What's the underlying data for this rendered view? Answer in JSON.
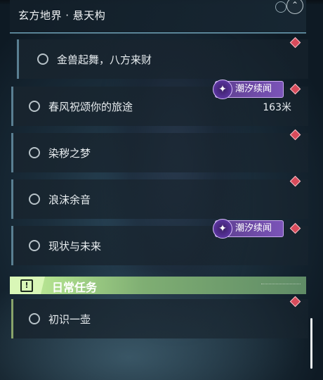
{
  "region": {
    "title": "玄方地界 · 悬天构",
    "close_icon": "chevron-up-icon"
  },
  "quests": [
    {
      "label": "金兽起舞，八方来财",
      "distance": "",
      "badge": ""
    },
    {
      "label": "春风祝颂你的旅途",
      "distance": "163米",
      "badge": "潮汐续闻"
    },
    {
      "label": "染秽之梦",
      "distance": "",
      "badge": ""
    },
    {
      "label": "浪沫余音",
      "distance": "",
      "badge": ""
    },
    {
      "label": "现状与未来",
      "distance": "",
      "badge": "潮汐续闻"
    }
  ],
  "daily_section": {
    "title": "日常任务",
    "icon": "exclamation-icon"
  },
  "daily_quests": [
    {
      "label": "初识一壶"
    }
  ],
  "colors": {
    "badge": "#7b54b8",
    "marker": "#d84b5b",
    "daily_accent": "#c9f29e"
  }
}
